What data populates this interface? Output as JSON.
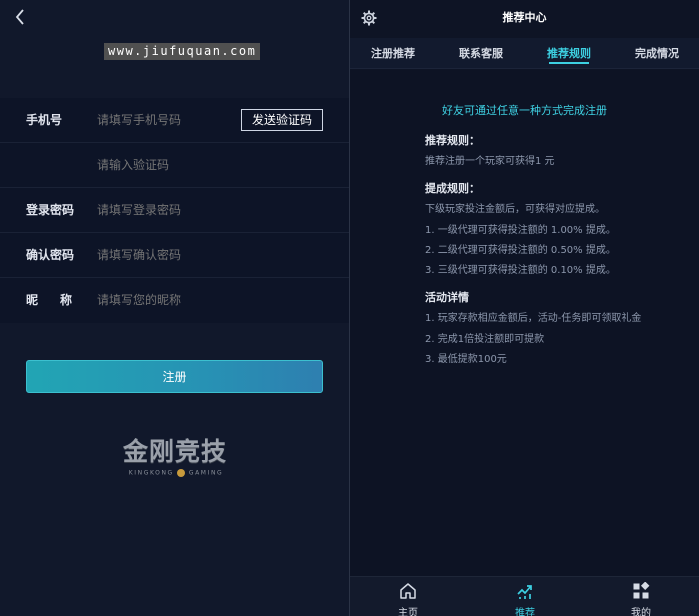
{
  "watermark": "www.jiufuquan.com",
  "register": {
    "fields": [
      {
        "label": "手机号",
        "placeholder": "请填写手机号码"
      },
      {
        "label": "",
        "placeholder": "请输入验证码"
      },
      {
        "label": "登录密码",
        "placeholder": "请填写登录密码"
      },
      {
        "label": "确认密码",
        "placeholder": "请填写确认密码"
      },
      {
        "label": "昵称",
        "placeholder": "请填写您的昵称"
      }
    ],
    "send_code_label": "发送验证码",
    "submit_label": "注册"
  },
  "logo": {
    "main": "金刚竞技",
    "sub_left": "KINGKONG",
    "sub_right": "GAMING"
  },
  "referral": {
    "title": "推荐中心",
    "tabs": [
      "注册推荐",
      "联系客服",
      "推荐规则",
      "完成情况"
    ],
    "active_tab": 2,
    "headline": "好友可通过任意一种方式完成注册",
    "sections": [
      {
        "title": "推荐规则：",
        "lines": [
          "推荐注册一个玩家可获得1 元"
        ]
      },
      {
        "title": "提成规则：",
        "lines": [
          "下级玩家投注金额后，可获得对应提成。",
          "1. 一级代理可获得投注额的 1.00% 提成。",
          "2. 二级代理可获得投注额的 0.50% 提成。",
          "3. 三级代理可获得投注额的 0.10% 提成。"
        ]
      },
      {
        "title": "活动详情",
        "lines": [
          "1. 玩家存款相应金额后，活动-任务即可领取礼金",
          "2. 完成1倍投注额即可提款",
          "3. 最低提款100元"
        ]
      }
    ]
  },
  "bottom_nav": {
    "items": [
      {
        "label": "主页",
        "icon": "home-icon"
      },
      {
        "label": "推荐",
        "icon": "trend-icon"
      },
      {
        "label": "我的",
        "icon": "grid-icon"
      }
    ],
    "active": 1
  },
  "colors": {
    "accent": "#3dd0e2",
    "background": "#0d1324",
    "button": "#22a5b4"
  }
}
